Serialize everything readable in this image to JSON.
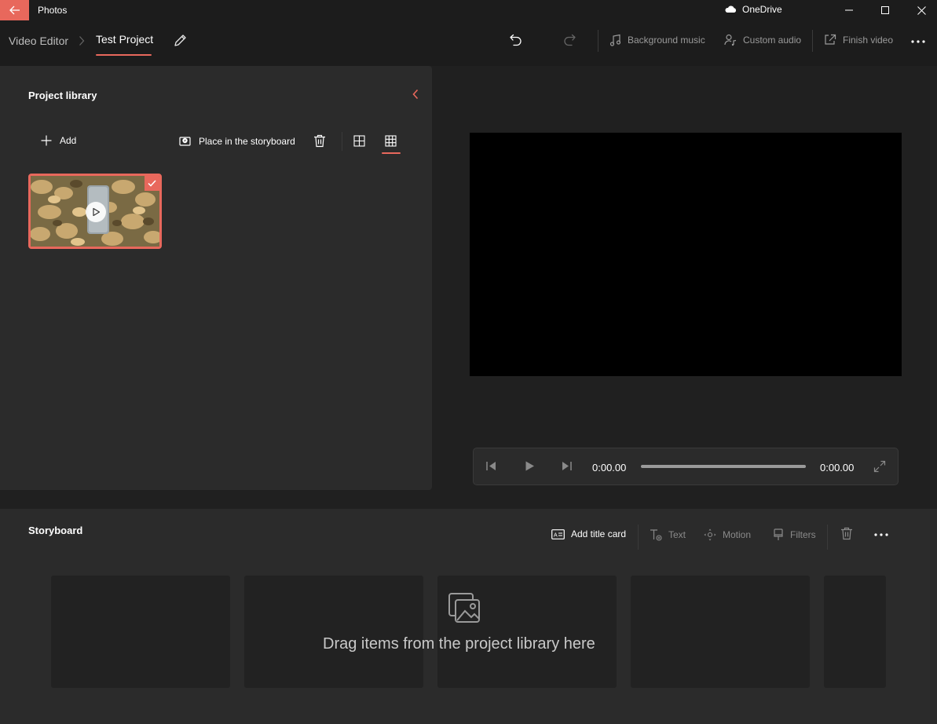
{
  "titlebar": {
    "app_title": "Photos",
    "onedrive_label": "OneDrive",
    "back_icon": "arrow-left-icon",
    "accent_color": "#e8685c"
  },
  "header": {
    "breadcrumb_root": "Video Editor",
    "breadcrumb_current": "Test Project",
    "actions": {
      "background_music": "Background music",
      "custom_audio": "Custom audio",
      "finish_video": "Finish video"
    }
  },
  "library": {
    "title": "Project library",
    "add_label": "Add",
    "place_label": "Place in the storyboard",
    "view_mode": "small-grid",
    "items": [
      {
        "type": "video",
        "selected": true,
        "thumbnail": "dry-leaves-on-ground"
      }
    ]
  },
  "player": {
    "current_time": "0:00.00",
    "total_time": "0:00.00",
    "progress": 0
  },
  "storyboard": {
    "title": "Storyboard",
    "add_title_card": "Add title card",
    "text": "Text",
    "motion": "Motion",
    "filters": "Filters",
    "drop_hint": "Drag items from the project library here",
    "slot_count": 5
  },
  "colors": {
    "background": "#202020",
    "panel": "#2b2b2b",
    "accent": "#e8685c",
    "disabled_text": "#8a8a8a"
  }
}
